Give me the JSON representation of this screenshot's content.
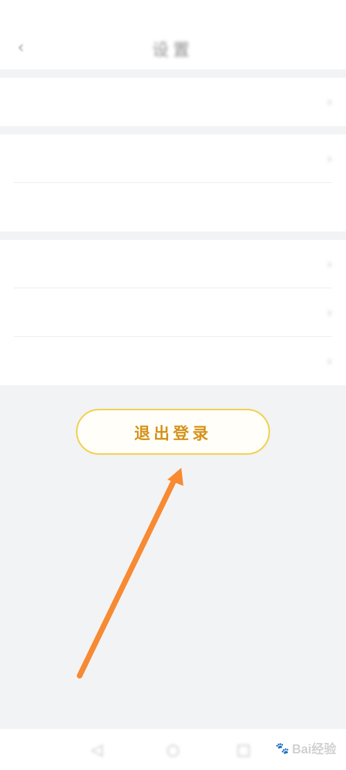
{
  "status_bar": {
    "left_text": "",
    "right_text": ""
  },
  "header": {
    "back_icon": "chevron-left-icon",
    "title": "设置"
  },
  "highlight_row": {
    "text": "",
    "right_text": "",
    "text_color": "#6fcf6b"
  },
  "sections": [
    {
      "rows": [
        {
          "label": "",
          "right_text": "",
          "chevron": true
        },
        {
          "label": "",
          "right_text": "",
          "chevron": false
        }
      ]
    },
    {
      "rows": [
        {
          "label": "",
          "right_text": "",
          "chevron": true
        },
        {
          "label": "",
          "right_text": "",
          "chevron": true
        },
        {
          "label": "",
          "right_text": "",
          "chevron": true
        }
      ]
    }
  ],
  "logout_button": {
    "label": "退出登录",
    "border_color": "#f1cf4c",
    "text_color": "#d59219"
  },
  "annotation": {
    "arrow_color": "#f78a32"
  },
  "bottom_nav": {
    "back_icon": "triangle-back-icon",
    "home_icon": "circle-home-icon",
    "recent_icon": "square-recent-icon"
  },
  "watermark": {
    "text": "Bai经验"
  }
}
